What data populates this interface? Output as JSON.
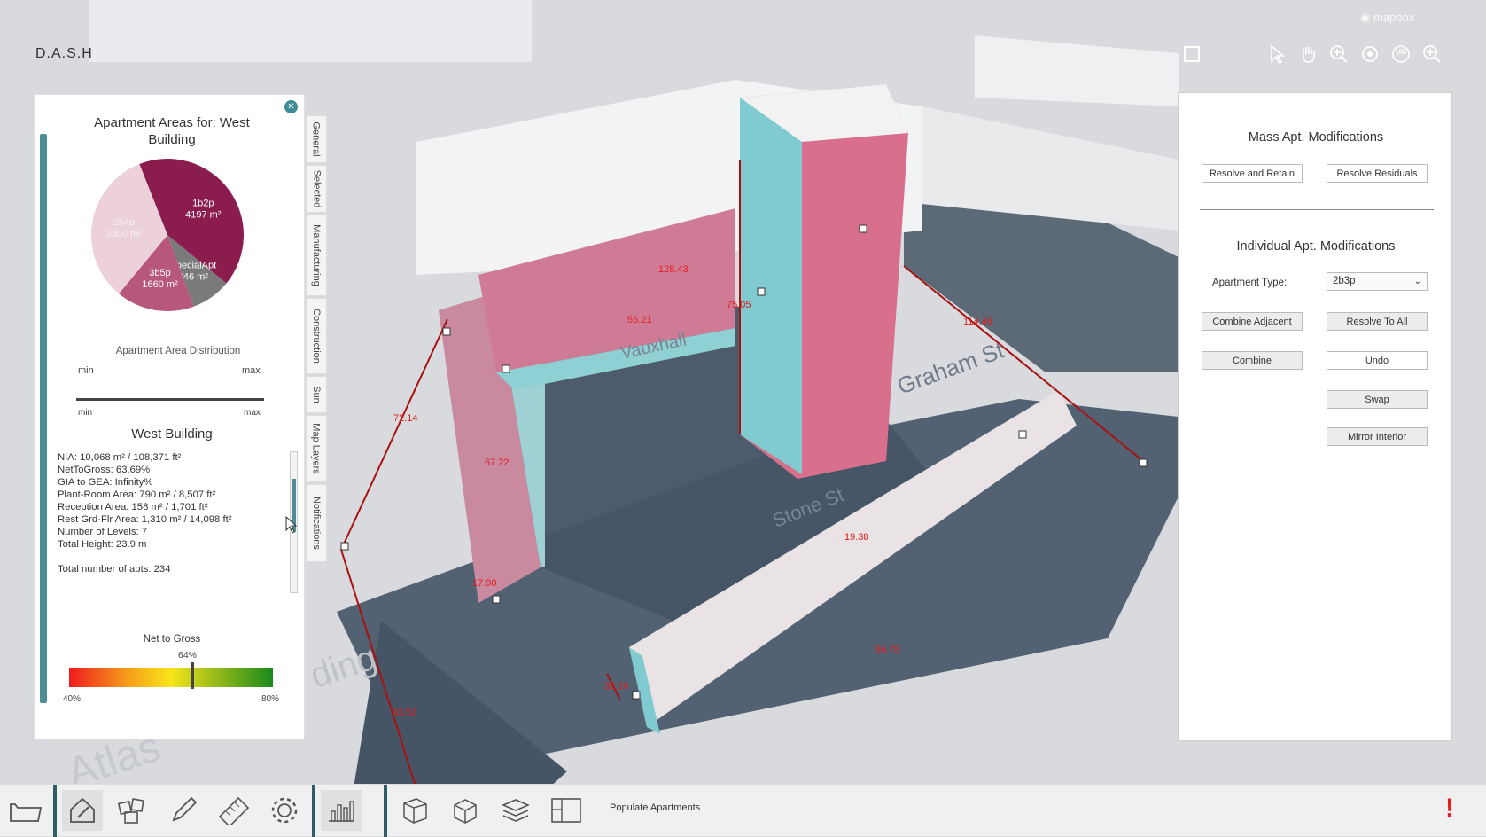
{
  "app": {
    "brand": "D.A.S.H",
    "map_credit": "mapbox"
  },
  "map_labels": {
    "street1": "Vauxhall",
    "street2": "Graham St",
    "street3": "Stone St",
    "area": "ding",
    "area2": "Atlas",
    "dims": [
      "128.43",
      "75.05",
      "55.21",
      "67.22",
      "17.90",
      "43.53",
      "56.78",
      "72.14",
      "114.46",
      "19.38",
      "32.10"
    ]
  },
  "left_panel": {
    "title": "Apartment Areas for: West Building",
    "pie": [
      {
        "label": "1b2p",
        "area": "4197 m²",
        "value": 4197,
        "color": "#8b1d4e"
      },
      {
        "label": "SpecialApt",
        "area": "846 m²",
        "value": 846,
        "color": "#7a7a7a"
      },
      {
        "label": "3b5p",
        "area": "1660 m²",
        "value": 1660,
        "color": "#b8577c"
      },
      {
        "label": "2b4p",
        "area": "3300 m²",
        "value": 3300,
        "color": "#ecd0da"
      }
    ],
    "distribution_label": "Apartment Area Distribution",
    "min": "min",
    "max": "max",
    "building_name": "West Building",
    "stats": [
      "NIA: 10,068 m² / 108,371 ft²",
      "NetToGross: 63.69%",
      "GIA to GEA: Infinity%",
      "Plant-Room Area: 790 m² / 8,507 ft²",
      "Reception Area: 158 m² / 1,701 ft²",
      "Rest Grd-Flr Area: 1,310 m² / 14,098 ft²",
      "Number of Levels: 7",
      "Total Height: 23.9 m",
      "",
      "Total number of apts: 234"
    ],
    "net_to_gross": {
      "label": "Net to Gross",
      "value_text": "64%",
      "value": 64,
      "min_text": "40%",
      "max_text": "80%"
    }
  },
  "tabs": [
    "General",
    "Selected",
    "Manufacturing",
    "Construction",
    "Sun",
    "Map Layers",
    "Notifications"
  ],
  "right_panel": {
    "mass_title": "Mass Apt. Modifications",
    "resolve_retain": "Resolve and Retain",
    "resolve_residuals": "Resolve Residuals",
    "individual_title": "Individual Apt. Modifications",
    "apt_type_label": "Apartment Type:",
    "apt_type_value": "2b3p",
    "combine_adjacent": "Combine Adjacent",
    "resolve_to_all": "Resolve To All",
    "combine": "Combine",
    "undo": "Undo",
    "swap": "Swap",
    "mirror_interior": "Mirror Interior"
  },
  "bottom": {
    "populate": "Populate Apartments",
    "alert": "!"
  }
}
